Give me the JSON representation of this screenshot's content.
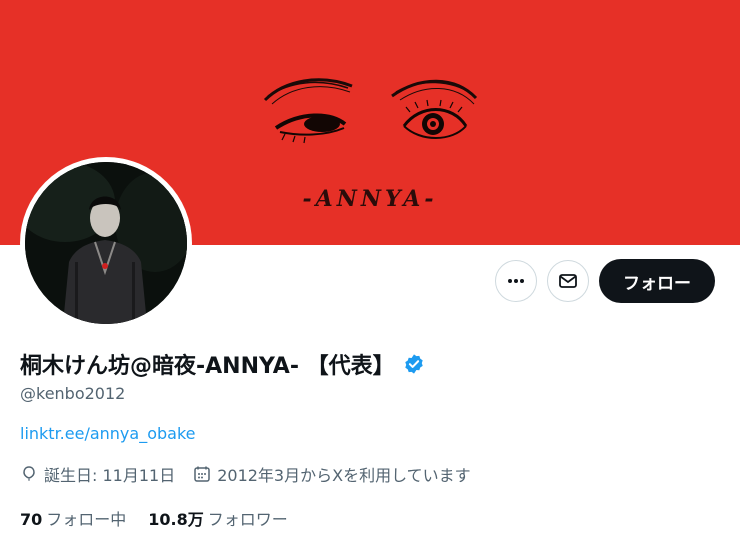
{
  "banner": {
    "text": "-ANNYA-",
    "color": "#e63027"
  },
  "profile": {
    "display_name": "桐木けん坊@暗夜-ANNYA- 【代表】",
    "handle": "@kenbo2012",
    "link": "linktr.ee/annya_obake",
    "birthday": "誕生日: 11月11日",
    "joined": "2012年3月からXを利用しています",
    "verified_color": "#1d9bf0"
  },
  "actions": {
    "more_icon": "more-icon",
    "message_icon": "mail-icon",
    "follow_label": "フォロー"
  },
  "stats": {
    "following_count": "70",
    "following_label": "フォロー中",
    "followers_count": "10.8万",
    "followers_label": "フォロワー"
  }
}
